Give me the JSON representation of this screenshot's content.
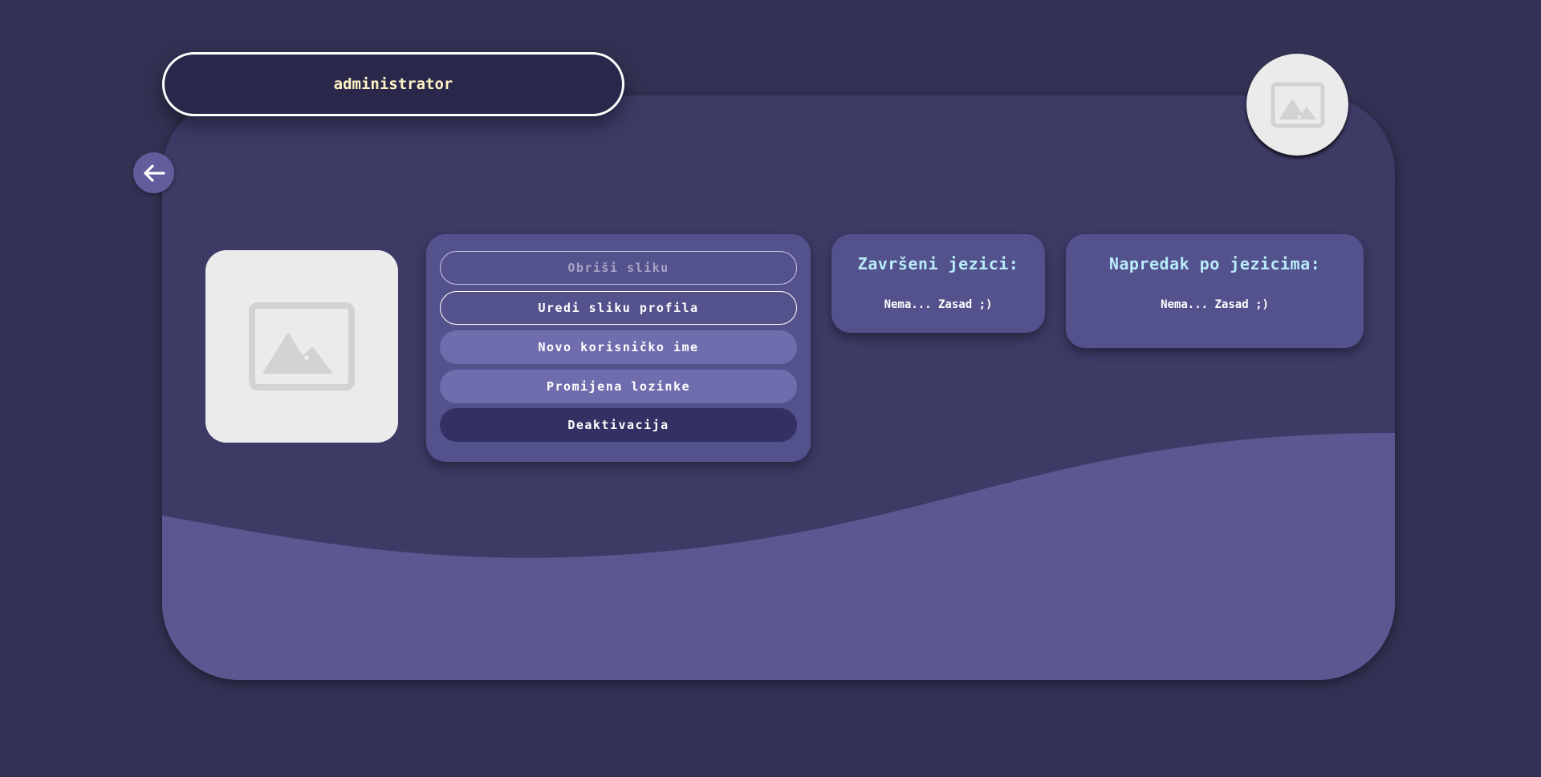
{
  "header": {
    "username": "administrator"
  },
  "icons": {
    "back": "arrow-left-icon",
    "avatar_placeholder": "image-placeholder-icon",
    "profile_placeholder": "image-placeholder-icon"
  },
  "actions": {
    "delete_image": "Obriši sliku",
    "edit_profile_image": "Uredi sliku profila",
    "new_username": "Novo korisničko ime",
    "change_password": "Promijena lozinke",
    "deactivate": "Deaktivacija"
  },
  "finished_languages": {
    "title": "Završeni jezici:",
    "empty_text": "Nema... Zasad ;)"
  },
  "language_progress": {
    "title": "Napredak po jezicima:",
    "empty_text": "Nema... Zasad ;)"
  },
  "colors": {
    "page_background": "#333254",
    "card": "#3d3b66",
    "wave": "#5b5891",
    "panel": "#54528d",
    "button_light": "#6f6dad",
    "button_dark": "#333163",
    "heading_text": "#b9ecfa",
    "username_text": "#fff3c4"
  }
}
